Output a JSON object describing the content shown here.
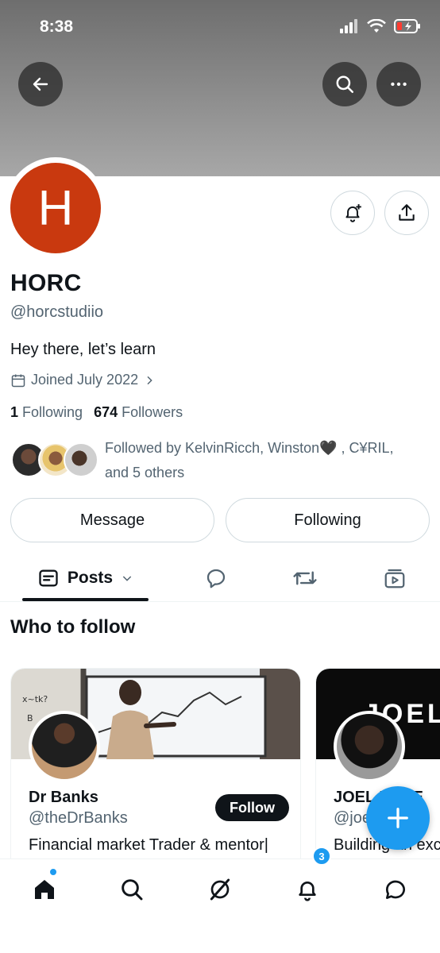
{
  "status_bar": {
    "time": "8:38"
  },
  "profile": {
    "avatar_letter": "H",
    "name": "HORC",
    "handle": "@horcstudiio",
    "bio": "Hey there, let’s learn",
    "joined": "Joined July 2022",
    "following_count": "1",
    "following_label": "Following",
    "followers_count": "674",
    "followers_label": "Followers",
    "followed_by_line1": "Followed by KelvinRicch, Winston🖤 , C¥RIL,",
    "followed_by_line2": "and 5 others"
  },
  "actions": {
    "message_label": "Message",
    "following_label": "Following"
  },
  "tabs": {
    "posts_label": "Posts"
  },
  "who_to_follow": {
    "title": "Who to follow",
    "cards": [
      {
        "name": "Dr Banks",
        "handle": "@theDrBanks",
        "description": "Financial market Trader & mentor|",
        "button": "Follow"
      },
      {
        "name": "JOEL EBAE",
        "handle": "@joelebaex",
        "description": "Building an exc",
        "banner_text": "JOEL"
      }
    ]
  },
  "notifications": {
    "badge_count": "3"
  },
  "colors": {
    "accent": "#1d9bf0",
    "avatar_bg": "#c9390f",
    "text": "#0f1419",
    "muted": "#536471"
  }
}
